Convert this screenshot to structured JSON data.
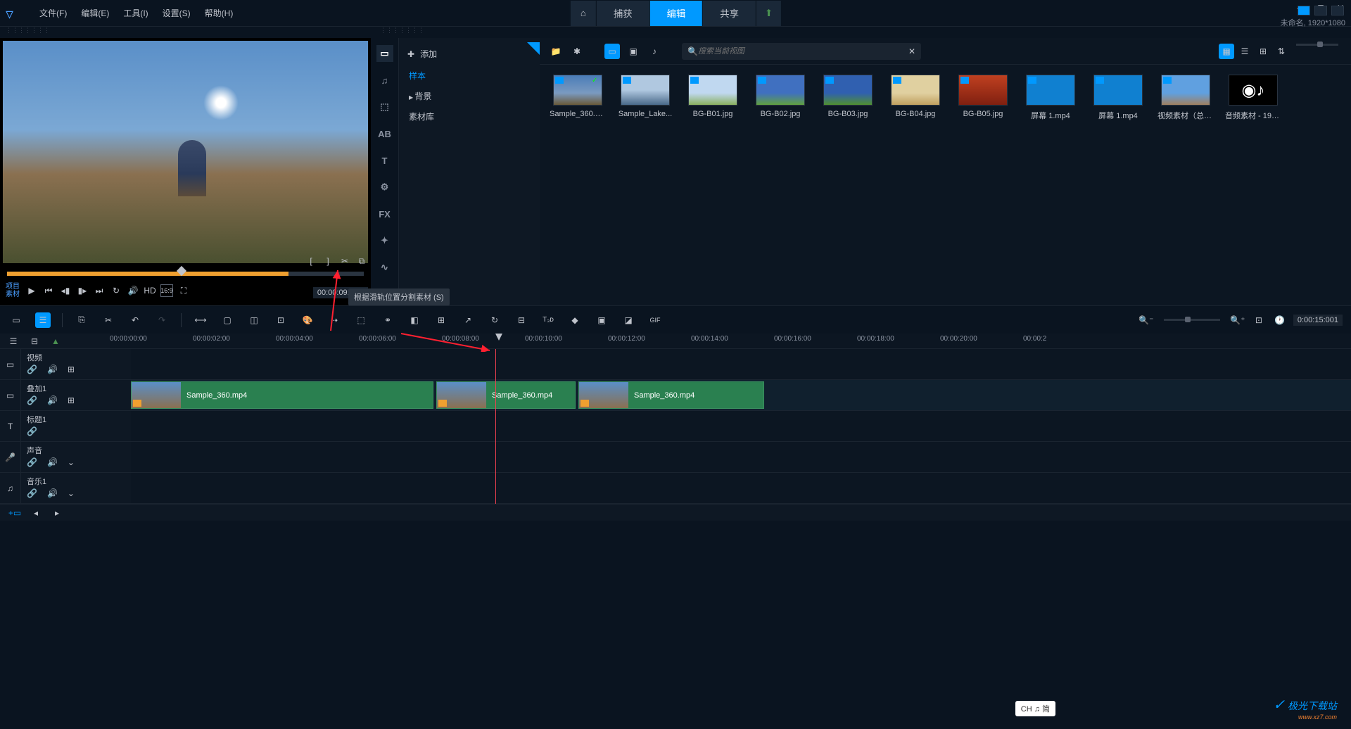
{
  "titlebar": {
    "menus": [
      "文件(F)",
      "编辑(E)",
      "工具(I)",
      "设置(S)",
      "帮助(H)"
    ],
    "tabs": {
      "capture": "捕获",
      "edit": "编辑",
      "share": "共享"
    },
    "resolution": "未命名, 1920*1080"
  },
  "preview": {
    "mode1": "项目",
    "mode2": "素材",
    "hd": "HD",
    "aspect": "16:9",
    "time": "00:00:09:00",
    "tooltip": "根据滑轨位置分割素材 (S)"
  },
  "library": {
    "add": "添加",
    "categories": {
      "sample": "样本",
      "background": "背景",
      "media": "素材库"
    },
    "search": "搜索当前视图",
    "items": [
      {
        "name": "Sample_360.m...",
        "thumb": "t-sky",
        "check": true
      },
      {
        "name": "Sample_Lake...",
        "thumb": "t-lake"
      },
      {
        "name": "BG-B01.jpg",
        "thumb": "t-b01"
      },
      {
        "name": "BG-B02.jpg",
        "thumb": "t-b02"
      },
      {
        "name": "BG-B03.jpg",
        "thumb": "t-b03"
      },
      {
        "name": "BG-B04.jpg",
        "thumb": "t-b04"
      },
      {
        "name": "BG-B05.jpg",
        "thumb": "t-b05"
      },
      {
        "name": "屏幕 1.mp4",
        "thumb": "t-screen"
      },
      {
        "name": "屏幕 1.mp4",
        "thumb": "t-screen"
      },
      {
        "name": "视频素材（总）...",
        "thumb": "t-video"
      },
      {
        "name": "音频素材 - 196...",
        "thumb": "audio"
      }
    ]
  },
  "timeline": {
    "duration": "0:00:15:001",
    "ruler": [
      "00:00:00:00",
      "00:00:02:00",
      "00:00:04:00",
      "00:00:06:00",
      "00:00:08:00",
      "00:00:10:00",
      "00:00:12:00",
      "00:00:14:00",
      "00:00:16:00",
      "00:00:18:00",
      "00:00:20:00",
      "00:00:2"
    ],
    "tracks": {
      "video": "视频",
      "overlay": "叠加1",
      "title": "标题1",
      "sound": "声音",
      "music": "音乐1"
    },
    "clip": "Sample_360.mp4"
  },
  "bottom": {
    "ime": "CH ♫ 简",
    "watermark": "极光下载站"
  }
}
